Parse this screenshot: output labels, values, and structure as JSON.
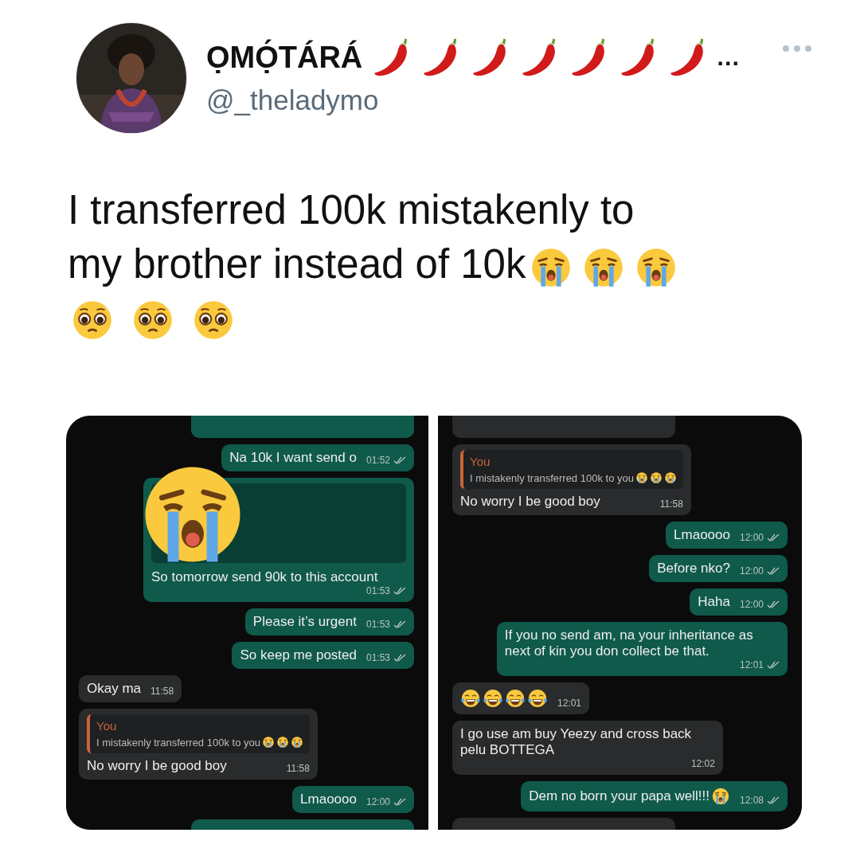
{
  "tweet": {
    "author": {
      "name": "ỌMỌ́TÁRÁ",
      "name_emojis": [
        {
          "kind": "pepper"
        },
        {
          "kind": "pepper"
        },
        {
          "kind": "pepper"
        },
        {
          "kind": "pepper"
        },
        {
          "kind": "pepper"
        },
        {
          "kind": "pepper"
        },
        {
          "kind": "pepper"
        }
      ],
      "name_cut": "…",
      "handle": "@_theladymo"
    },
    "text_lines": [
      "I transferred 100k mistakenly to",
      "my brother instead of 10k"
    ],
    "text_emojis": [
      {
        "kind": "crying"
      },
      {
        "kind": "crying"
      },
      {
        "kind": "crying"
      }
    ],
    "line_emojis": [
      {
        "kind": "pleading"
      },
      {
        "kind": "pleading"
      },
      {
        "kind": "pleading"
      }
    ]
  },
  "chats": [
    {
      "messages": [
        {
          "kind": "partial",
          "outgoing": true
        },
        {
          "kind": "text",
          "outgoing": true,
          "text": "Na 10k I want send o",
          "time": "01:52",
          "delivered": true
        },
        {
          "kind": "covered",
          "outgoing": true,
          "sticker": {
            "kind": "crying"
          },
          "text": "So tomorrow send 90k to this account",
          "time": "01:53",
          "delivered": true
        },
        {
          "kind": "text",
          "outgoing": true,
          "text": "Please it’s urgent",
          "time": "01:53",
          "delivered": true
        },
        {
          "kind": "text",
          "outgoing": true,
          "text": "So keep me posted",
          "time": "01:53",
          "delivered": true
        },
        {
          "kind": "text",
          "outgoing": false,
          "text": "Okay ma",
          "time": "11:58",
          "delivered": false
        },
        {
          "kind": "reply",
          "outgoing": false,
          "quote_author": "You",
          "quote_text": "I mistakenly transferred 100k to you",
          "quote_emojis": [
            {
              "kind": "crying"
            },
            {
              "kind": "crying"
            },
            {
              "kind": "crying"
            }
          ],
          "text": "No worry I be good boy",
          "time": "11:58",
          "delivered": false
        },
        {
          "kind": "text",
          "outgoing": true,
          "text": "Lmaoooo",
          "time": "12:00",
          "delivered": true
        },
        {
          "kind": "partial",
          "outgoing": true
        }
      ]
    },
    {
      "messages": [
        {
          "kind": "partial",
          "outgoing": false
        },
        {
          "kind": "reply",
          "outgoing": false,
          "quote_author": "You",
          "quote_text": "I mistakenly transferred 100k to you",
          "quote_emojis": [
            {
              "kind": "crying"
            },
            {
              "kind": "crying"
            },
            {
              "kind": "crying"
            }
          ],
          "text": "No worry I be good boy",
          "time": "11:58",
          "delivered": false
        },
        {
          "kind": "text",
          "outgoing": true,
          "text": "Lmaoooo",
          "time": "12:00",
          "delivered": true
        },
        {
          "kind": "text",
          "outgoing": true,
          "text": "Before nko?",
          "time": "12:00",
          "delivered": true
        },
        {
          "kind": "text",
          "outgoing": true,
          "text": "Haha",
          "time": "12:00",
          "delivered": true
        },
        {
          "kind": "text",
          "outgoing": true,
          "text": "If you no send am, na your inheritance as next of kin you don collect be that.",
          "time": "12:01",
          "delivered": true
        },
        {
          "kind": "emoji",
          "outgoing": false,
          "emojis": [
            {
              "kind": "laughing"
            },
            {
              "kind": "laughing"
            },
            {
              "kind": "laughing"
            },
            {
              "kind": "laughing"
            }
          ],
          "time": "12:01",
          "delivered": false
        },
        {
          "kind": "text",
          "outgoing": false,
          "text": "I go use am buy Yeezy and cross back pelu BOTTEGA",
          "time": "12:02",
          "delivered": false
        },
        {
          "kind": "text",
          "outgoing": true,
          "text": "Dem no born your papa well!!!",
          "emojis": [
            {
              "kind": "crying"
            }
          ],
          "time": "12:08",
          "delivered": true
        },
        {
          "kind": "partial",
          "outgoing": false
        }
      ]
    }
  ]
}
